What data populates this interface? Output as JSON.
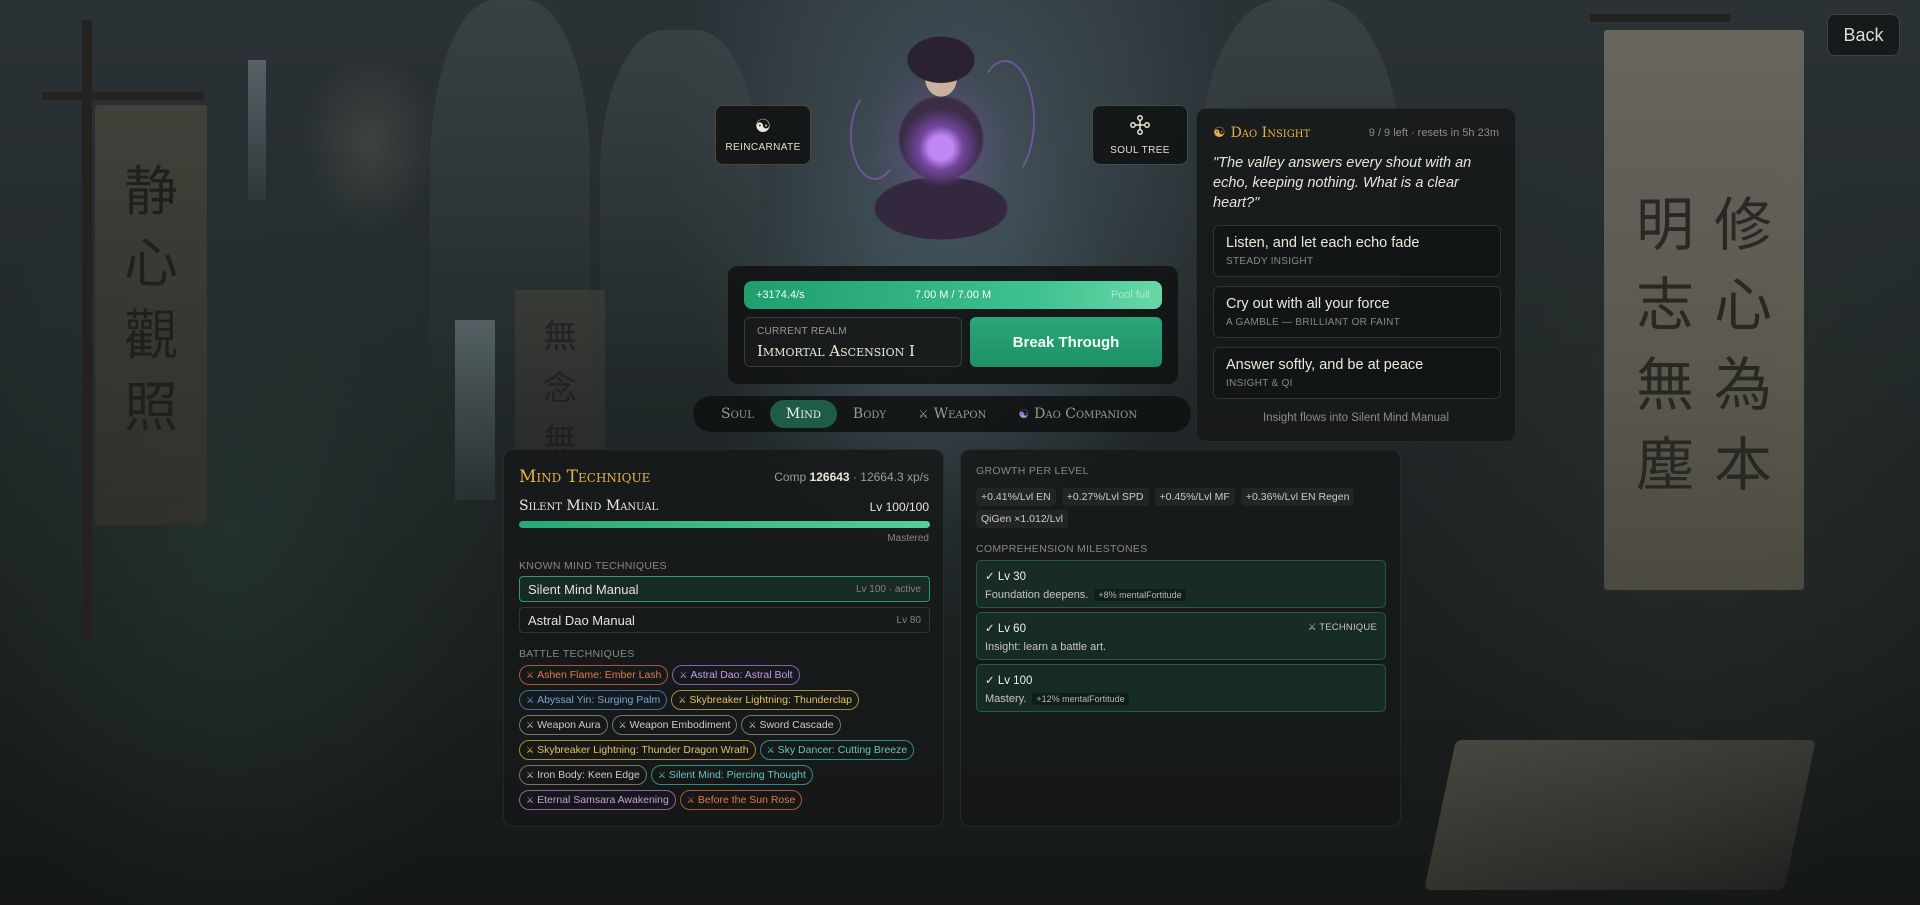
{
  "header": {
    "back_label": "Back"
  },
  "actions": {
    "reincarnate": {
      "label": "REINCARNATE",
      "icon": "yin-yang-icon",
      "glyph": "☯"
    },
    "soul_tree": {
      "label": "SOUL TREE",
      "icon": "soul-tree-icon",
      "glyph": "⌘"
    }
  },
  "background": {
    "left_banner": [
      "静",
      "心",
      "觀",
      "照"
    ],
    "right_banner_col1": [
      "修",
      "心",
      "為",
      "本"
    ],
    "right_banner_col2": [
      "明",
      "志",
      "無",
      "塵"
    ],
    "center_banner": [
      "無",
      "念",
      "無"
    ]
  },
  "cultivation": {
    "rate": "+3174.4/s",
    "amount": "7.00 M / 7.00 M",
    "status": "Pool full",
    "fill_fraction": 1.0,
    "realm_label": "CURRENT REALM",
    "realm_value": "Immortal Ascension I",
    "break_label": "Break Through"
  },
  "tabs": [
    {
      "label": "Soul",
      "active": false,
      "icon": ""
    },
    {
      "label": "Mind",
      "active": true,
      "icon": ""
    },
    {
      "label": "Body",
      "active": false,
      "icon": ""
    },
    {
      "label": "Weapon",
      "active": false,
      "icon": "⚔"
    },
    {
      "label": "Dao Companion",
      "active": false,
      "icon": "☯"
    }
  ],
  "insight": {
    "icon": "☯",
    "title": "Dao Insight",
    "meta": "9 / 9 left · resets in 5h 23m",
    "quote": "\"The valley answers every shout with an echo, keeping nothing. What is a clear heart?\"",
    "choices": [
      {
        "title": "Listen, and let each echo fade",
        "sub": "STEADY INSIGHT"
      },
      {
        "title": "Cry out with all your force",
        "sub": "A GAMBLE — BRILLIANT OR FAINT"
      },
      {
        "title": "Answer softly, and be at peace",
        "sub": "INSIGHT & QI"
      }
    ],
    "footer": "Insight flows into Silent Mind Manual"
  },
  "mind": {
    "title": "Mind Technique",
    "comp_prefix": "Comp",
    "comp_value": "126643",
    "comp_rate": "· 12664.3 xp/s",
    "manual_name": "Silent Mind Manual",
    "manual_level": "Lv 100/100",
    "progress_fraction": 1.0,
    "mastered": "Mastered",
    "known_label": "KNOWN MIND TECHNIQUES",
    "known": [
      {
        "name": "Silent Mind Manual",
        "level": "Lv 100 · active",
        "active": true
      },
      {
        "name": "Astral Dao Manual",
        "level": "Lv 80",
        "active": false
      }
    ],
    "battle_label": "BATTLE TECHNIQUES",
    "battle": [
      {
        "name": "Ashen Flame: Ember Lash",
        "color": "orange"
      },
      {
        "name": "Astral Dao: Astral Bolt",
        "color": "purple"
      },
      {
        "name": "Abyssal Yin: Surging Palm",
        "color": "blue"
      },
      {
        "name": "Skybreaker Lightning: Thunderclap",
        "color": "yellow"
      },
      {
        "name": "Weapon Aura",
        "color": "gray"
      },
      {
        "name": "Weapon Embodiment",
        "color": "gray"
      },
      {
        "name": "Sword Cascade",
        "color": "gray"
      },
      {
        "name": "Skybreaker Lightning: Thunder Dragon Wrath",
        "color": "yellow"
      },
      {
        "name": "Sky Dancer: Cutting Breeze",
        "color": "teal"
      },
      {
        "name": "Iron Body: Keen Edge",
        "color": "gray"
      },
      {
        "name": "Silent Mind: Piercing Thought",
        "color": "teal"
      },
      {
        "name": "Eternal Samsara Awakening",
        "color": "purple"
      },
      {
        "name": "Before the Sun Rose",
        "color": "orange"
      }
    ]
  },
  "growth": {
    "label": "GROWTH PER LEVEL",
    "tags": [
      "+0.41%/Lvl EN",
      "+0.27%/Lvl SPD",
      "+0.45%/Lvl MF",
      "+0.36%/Lvl EN Regen",
      "QiGen ×1.012/Lvl"
    ],
    "milestones_label": "COMPREHENSION MILESTONES",
    "milestones": [
      {
        "level": "✓ Lv 30",
        "desc": "Foundation deepens.",
        "tag": "+8% mentalFortitude",
        "right": ""
      },
      {
        "level": "✓ Lv 60",
        "desc": "Insight: learn a battle art.",
        "tag": "",
        "right": "⚔ TECHNIQUE"
      },
      {
        "level": "✓ Lv 100",
        "desc": "Mastery.",
        "tag": "+12% mentalFortitude",
        "right": ""
      }
    ]
  },
  "colors": {
    "accent_gold": "#e6b24c",
    "qi_green": "#3fc28f",
    "break_green": "#2aa778",
    "active_tab": "#1f5b45"
  }
}
